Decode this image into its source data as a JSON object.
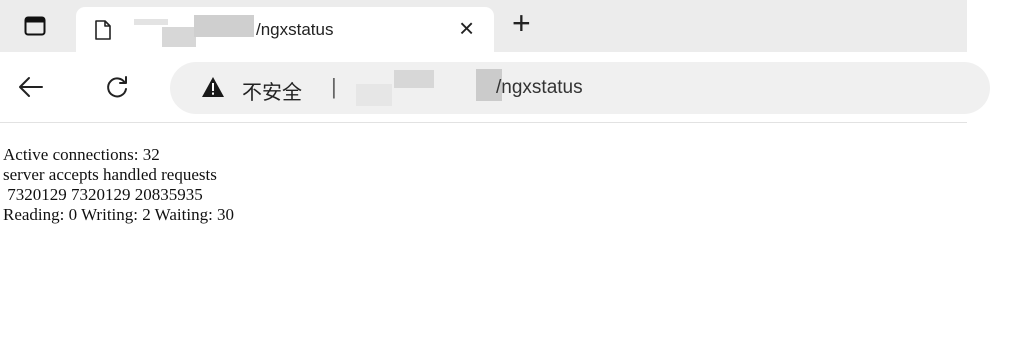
{
  "tab": {
    "title": "/ngxstatus",
    "close_glyph": "×",
    "new_tab_glyph": "+"
  },
  "address_bar": {
    "security_label": "不安全",
    "separator": "|",
    "url_path": "/ngxstatus"
  },
  "icons": {
    "tab_actions": "tab-actions-icon",
    "page": "page-icon",
    "back": "back-arrow-icon",
    "refresh": "refresh-icon",
    "warning": "warning-icon"
  },
  "colors": {
    "tabstrip_bg": "#ececec",
    "address_bar_bg": "#f0f0f0",
    "redaction_gray": "#cfcfcf"
  },
  "page_content": {
    "lines": [
      "Active connections: 32",
      "server accepts handled requests",
      " 7320129 7320129 20835935",
      "Reading: 0 Writing: 2 Waiting: 30"
    ]
  }
}
